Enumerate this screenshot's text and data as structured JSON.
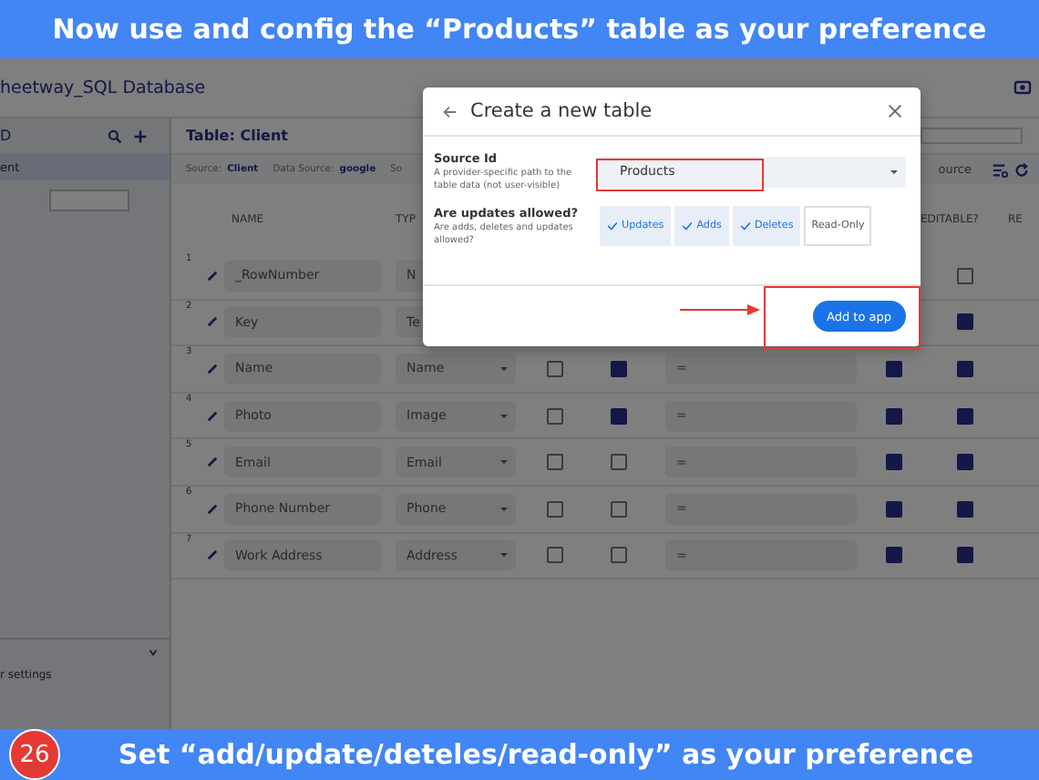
{
  "top_banner": {
    "text": "Now use and config the “Products” table as your preference"
  },
  "app": {
    "title": "heetway_SQL Database",
    "sidebar": {
      "header": "D",
      "items": [
        {
          "label": "ent",
          "selected": true
        }
      ],
      "footer": "r settings"
    },
    "table_title": "Table: Client",
    "source_row": [
      {
        "label": "Source:",
        "value": "Client"
      },
      {
        "label": "Data Source:",
        "value": "google"
      },
      {
        "label": "So"
      }
    ],
    "toolbar": {
      "source_button": "ource"
    },
    "columns": [
      {
        "kind": "name",
        "label": "NAME"
      },
      {
        "kind": "type",
        "label": "TYP"
      },
      {
        "kind": "editable",
        "label": "EDITABLE?"
      },
      {
        "kind": "cut",
        "label": "RE"
      }
    ],
    "rows": [
      {
        "number": "1",
        "name": "_RowNumber",
        "type": "N",
        "editable": false
      },
      {
        "number": "2",
        "name": "Key",
        "type": "Te",
        "editable": true
      },
      {
        "number": "3",
        "name": "Name",
        "type": "Name",
        "column_3_checked": false,
        "column_4_checked": true,
        "formula": "=",
        "column_6_checked": true,
        "editable": true
      },
      {
        "number": "4",
        "name": "Photo",
        "type": "Image",
        "column_3_checked": false,
        "column_4_checked": true,
        "formula": "=",
        "column_6_checked": true,
        "editable": true
      },
      {
        "number": "5",
        "name": "Email",
        "type": "Email",
        "column_3_checked": false,
        "column_4_checked": false,
        "formula": "=",
        "column_6_checked": true,
        "editable": true
      },
      {
        "number": "6",
        "name": "Phone Number",
        "type": "Phone",
        "column_3_checked": false,
        "column_4_checked": false,
        "formula": "=",
        "column_6_checked": true,
        "editable": true
      },
      {
        "number": "7",
        "name": "Work Address",
        "type": "Address",
        "column_3_checked": false,
        "column_4_checked": false,
        "formula": "=",
        "column_6_checked": true,
        "editable": true
      }
    ]
  },
  "dialog": {
    "title": "Create a new table",
    "source_id": {
      "label": "Source Id",
      "description": "A provider-specific path to the table data (not user-visible)",
      "value": "Products"
    },
    "updates": {
      "label": "Are updates allowed?",
      "description": "Are adds, deletes and updates allowed?",
      "options": [
        {
          "label": "Updates",
          "selected": true
        },
        {
          "label": "Adds",
          "selected": true
        },
        {
          "label": "Deletes",
          "selected": true
        },
        {
          "label": "Read-Only",
          "selected": false
        }
      ]
    },
    "primary_button": "Add to app"
  },
  "bottom_banner": {
    "step": "26",
    "text": "Set “add/update/deteles/read-only” as your preference"
  }
}
